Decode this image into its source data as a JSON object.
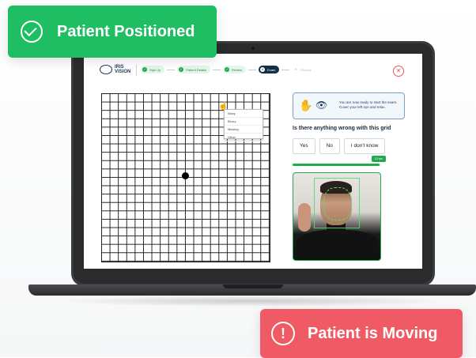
{
  "badges": {
    "positioned": {
      "label": "Patient Positioned",
      "icon": "check-circle-icon",
      "color": "#1fbe63"
    },
    "moving": {
      "label": "Patient is Moving",
      "icon": "exclamation-circle-icon",
      "color": "#f05a64"
    }
  },
  "app": {
    "logo": "IRIS VISION",
    "steps": [
      {
        "label": "Sign Up",
        "state": "done",
        "icon": "✓"
      },
      {
        "label": "Patient Details",
        "state": "done",
        "icon": "✓"
      },
      {
        "label": "Review",
        "state": "done",
        "icon": "✓"
      },
      {
        "label": "Exam",
        "state": "active",
        "icon": "4"
      },
      {
        "label": "Results",
        "state": "pending",
        "icon": "5"
      }
    ],
    "close_icon": "close-icon"
  },
  "grid_menu": {
    "options": [
      "Wavy",
      "Blurry",
      "Missing",
      "Other"
    ]
  },
  "exam": {
    "instruction": "You are now ready to start the exam. Cover your left eye and relax.",
    "question": "Is there anything wrong with this grid",
    "answers": [
      "Yes",
      "No",
      "I don't know"
    ],
    "timer": "12 sec",
    "progress": 0.98
  },
  "colors": {
    "accent": "#22a94f",
    "navy": "#12304a",
    "alert": "#e05a5a"
  }
}
